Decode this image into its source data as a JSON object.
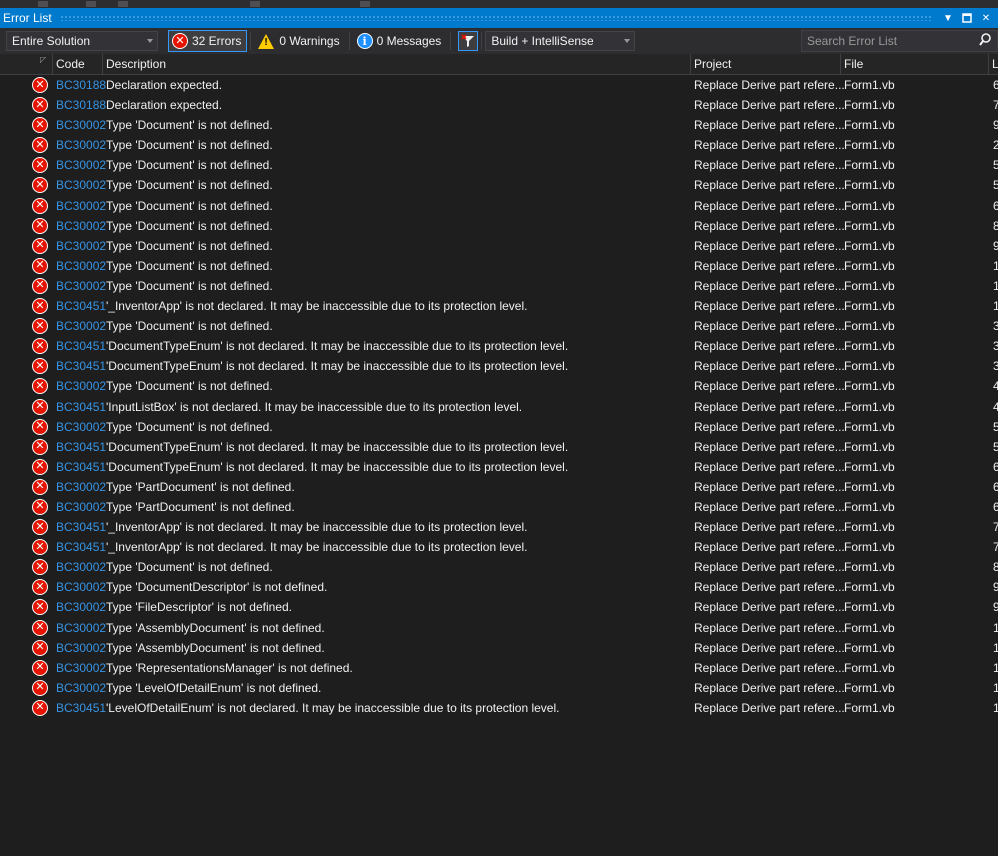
{
  "window": {
    "title": "Error List"
  },
  "toolbar": {
    "scope": "Entire Solution",
    "errors_label": "32 Errors",
    "warnings_label": "0 Warnings",
    "messages_label": "0 Messages",
    "build_filter": "Build + IntelliSense",
    "search_placeholder": "Search Error List"
  },
  "columns": {
    "code": "Code",
    "description": "Description",
    "project": "Project",
    "file": "File",
    "line": "L"
  },
  "rows": [
    {
      "code": "BC30188",
      "description": "Declaration expected.",
      "project": "Replace Derive part refere...",
      "file": "Form1.vb",
      "line": "6"
    },
    {
      "code": "BC30188",
      "description": "Declaration expected.",
      "project": "Replace Derive part refere...",
      "file": "Form1.vb",
      "line": "7"
    },
    {
      "code": "BC30002",
      "description": "Type 'Document' is not defined.",
      "project": "Replace Derive part refere...",
      "file": "Form1.vb",
      "line": "9"
    },
    {
      "code": "BC30002",
      "description": "Type 'Document' is not defined.",
      "project": "Replace Derive part refere...",
      "file": "Form1.vb",
      "line": "2"
    },
    {
      "code": "BC30002",
      "description": "Type 'Document' is not defined.",
      "project": "Replace Derive part refere...",
      "file": "Form1.vb",
      "line": "5"
    },
    {
      "code": "BC30002",
      "description": "Type 'Document' is not defined.",
      "project": "Replace Derive part refere...",
      "file": "Form1.vb",
      "line": "5"
    },
    {
      "code": "BC30002",
      "description": "Type 'Document' is not defined.",
      "project": "Replace Derive part refere...",
      "file": "Form1.vb",
      "line": "6"
    },
    {
      "code": "BC30002",
      "description": "Type 'Document' is not defined.",
      "project": "Replace Derive part refere...",
      "file": "Form1.vb",
      "line": "8"
    },
    {
      "code": "BC30002",
      "description": "Type 'Document' is not defined.",
      "project": "Replace Derive part refere...",
      "file": "Form1.vb",
      "line": "9"
    },
    {
      "code": "BC30002",
      "description": "Type 'Document' is not defined.",
      "project": "Replace Derive part refere...",
      "file": "Form1.vb",
      "line": "1"
    },
    {
      "code": "BC30002",
      "description": "Type 'Document' is not defined.",
      "project": "Replace Derive part refere...",
      "file": "Form1.vb",
      "line": "1"
    },
    {
      "code": "BC30451",
      "description": "'_InventorApp' is not declared. It may be inaccessible due to its protection level.",
      "project": "Replace Derive part refere...",
      "file": "Form1.vb",
      "line": "1"
    },
    {
      "code": "BC30002",
      "description": "Type 'Document' is not defined.",
      "project": "Replace Derive part refere...",
      "file": "Form1.vb",
      "line": "3"
    },
    {
      "code": "BC30451",
      "description": "'DocumentTypeEnum' is not declared. It may be inaccessible due to its protection level.",
      "project": "Replace Derive part refere...",
      "file": "Form1.vb",
      "line": "3"
    },
    {
      "code": "BC30451",
      "description": "'DocumentTypeEnum' is not declared. It may be inaccessible due to its protection level.",
      "project": "Replace Derive part refere...",
      "file": "Form1.vb",
      "line": "3"
    },
    {
      "code": "BC30002",
      "description": "Type 'Document' is not defined.",
      "project": "Replace Derive part refere...",
      "file": "Form1.vb",
      "line": "4"
    },
    {
      "code": "BC30451",
      "description": "'InputListBox' is not declared. It may be inaccessible due to its protection level.",
      "project": "Replace Derive part refere...",
      "file": "Form1.vb",
      "line": "4"
    },
    {
      "code": "BC30002",
      "description": "Type 'Document' is not defined.",
      "project": "Replace Derive part refere...",
      "file": "Form1.vb",
      "line": "5"
    },
    {
      "code": "BC30451",
      "description": "'DocumentTypeEnum' is not declared. It may be inaccessible due to its protection level.",
      "project": "Replace Derive part refere...",
      "file": "Form1.vb",
      "line": "5"
    },
    {
      "code": "BC30451",
      "description": "'DocumentTypeEnum' is not declared. It may be inaccessible due to its protection level.",
      "project": "Replace Derive part refere...",
      "file": "Form1.vb",
      "line": "6"
    },
    {
      "code": "BC30002",
      "description": "Type 'PartDocument' is not defined.",
      "project": "Replace Derive part refere...",
      "file": "Form1.vb",
      "line": "6"
    },
    {
      "code": "BC30002",
      "description": "Type 'PartDocument' is not defined.",
      "project": "Replace Derive part refere...",
      "file": "Form1.vb",
      "line": "6"
    },
    {
      "code": "BC30451",
      "description": "'_InventorApp' is not declared. It may be inaccessible due to its protection level.",
      "project": "Replace Derive part refere...",
      "file": "Form1.vb",
      "line": "7"
    },
    {
      "code": "BC30451",
      "description": "'_InventorApp' is not declared. It may be inaccessible due to its protection level.",
      "project": "Replace Derive part refere...",
      "file": "Form1.vb",
      "line": "7"
    },
    {
      "code": "BC30002",
      "description": "Type 'Document' is not defined.",
      "project": "Replace Derive part refere...",
      "file": "Form1.vb",
      "line": "8"
    },
    {
      "code": "BC30002",
      "description": "Type 'DocumentDescriptor' is not defined.",
      "project": "Replace Derive part refere...",
      "file": "Form1.vb",
      "line": "9"
    },
    {
      "code": "BC30002",
      "description": "Type 'FileDescriptor' is not defined.",
      "project": "Replace Derive part refere...",
      "file": "Form1.vb",
      "line": "9"
    },
    {
      "code": "BC30002",
      "description": "Type 'AssemblyDocument' is not defined.",
      "project": "Replace Derive part refere...",
      "file": "Form1.vb",
      "line": "1"
    },
    {
      "code": "BC30002",
      "description": "Type 'AssemblyDocument' is not defined.",
      "project": "Replace Derive part refere...",
      "file": "Form1.vb",
      "line": "1"
    },
    {
      "code": "BC30002",
      "description": "Type 'RepresentationsManager' is not defined.",
      "project": "Replace Derive part refere...",
      "file": "Form1.vb",
      "line": "1"
    },
    {
      "code": "BC30002",
      "description": "Type 'LevelOfDetailEnum' is not defined.",
      "project": "Replace Derive part refere...",
      "file": "Form1.vb",
      "line": "1"
    },
    {
      "code": "BC30451",
      "description": "'LevelOfDetailEnum' is not declared. It may be inaccessible due to its protection level.",
      "project": "Replace Derive part refere...",
      "file": "Form1.vb",
      "line": "1"
    }
  ],
  "icons": {
    "error": "error-icon",
    "warning": "warning-icon",
    "info": "info-icon",
    "filter": "filter-icon",
    "search": "search-icon"
  },
  "colors": {
    "accent": "#007acc",
    "error": "#e51400",
    "code_link": "#3794e4",
    "background": "#1e1e1e"
  }
}
